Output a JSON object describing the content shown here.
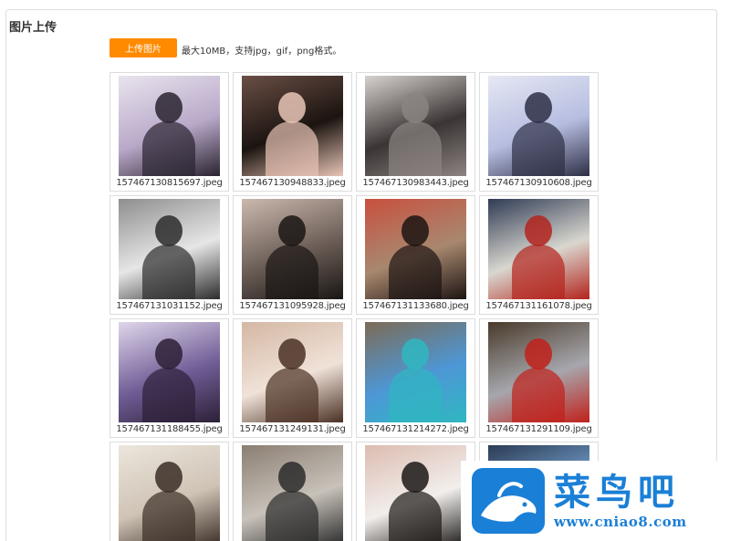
{
  "section": {
    "title": "图片上传"
  },
  "upload": {
    "button_label": "上传图片",
    "hint": "最大10MB，支持jpg，gif，png格式。",
    "button_color": "#ff8a00"
  },
  "images": [
    {
      "name": "157467130815697.jpeg",
      "palette": [
        "#b9a9c9",
        "#2a2330",
        "#e9e4ee"
      ]
    },
    {
      "name": "157467130948833.jpeg",
      "palette": [
        "#1b1410",
        "#e9c5b6",
        "#6a4f45"
      ]
    },
    {
      "name": "157467130983443.jpeg",
      "palette": [
        "#3a3434",
        "#8c8482",
        "#d8d2cf"
      ]
    },
    {
      "name": "157467130910608.jpeg",
      "palette": [
        "#b6bde0",
        "#2d2f45",
        "#e6e8f4"
      ]
    },
    {
      "name": "157467131031152.jpeg",
      "palette": [
        "#e6e6e6",
        "#2c2c2c",
        "#8e8e8e"
      ]
    },
    {
      "name": "157467131095928.jpeg",
      "palette": [
        "#6b5d56",
        "#1a1614",
        "#cbb9ae"
      ]
    },
    {
      "name": "157467131133680.jpeg",
      "palette": [
        "#a8886f",
        "#1d1412",
        "#c9503f"
      ]
    },
    {
      "name": "157467131161078.jpeg",
      "palette": [
        "#d9d7cf",
        "#b3241d",
        "#2f3b54"
      ]
    },
    {
      "name": "157467131188455.jpeg",
      "palette": [
        "#6f5d96",
        "#2c2036",
        "#e0d6ea"
      ]
    },
    {
      "name": "157467131249131.jpeg",
      "palette": [
        "#f0e2d8",
        "#4a3024",
        "#d4b7a3"
      ]
    },
    {
      "name": "157467131214272.jpeg",
      "palette": [
        "#4d97d6",
        "#2fb7c0",
        "#7d6b56"
      ]
    },
    {
      "name": "157467131291109.jpeg",
      "palette": [
        "#a6a7ad",
        "#c1201a",
        "#4a3a2a"
      ]
    },
    {
      "name": "",
      "palette": [
        "#cfc3b5",
        "#3a2e26",
        "#ece6dc"
      ]
    },
    {
      "name": "",
      "palette": [
        "#c8c2ba",
        "#2b2b2b",
        "#8b7e72"
      ]
    },
    {
      "name": "",
      "palette": [
        "#f2eeec",
        "#1b1816",
        "#dcbcb0"
      ]
    },
    {
      "name": "",
      "palette": [
        "#7aa8d8",
        "#ffffff",
        "#2b3b54"
      ]
    }
  ],
  "watermark": {
    "title": "菜鸟吧",
    "url": "www.cniao8.com",
    "color": "#1a7fd6"
  }
}
